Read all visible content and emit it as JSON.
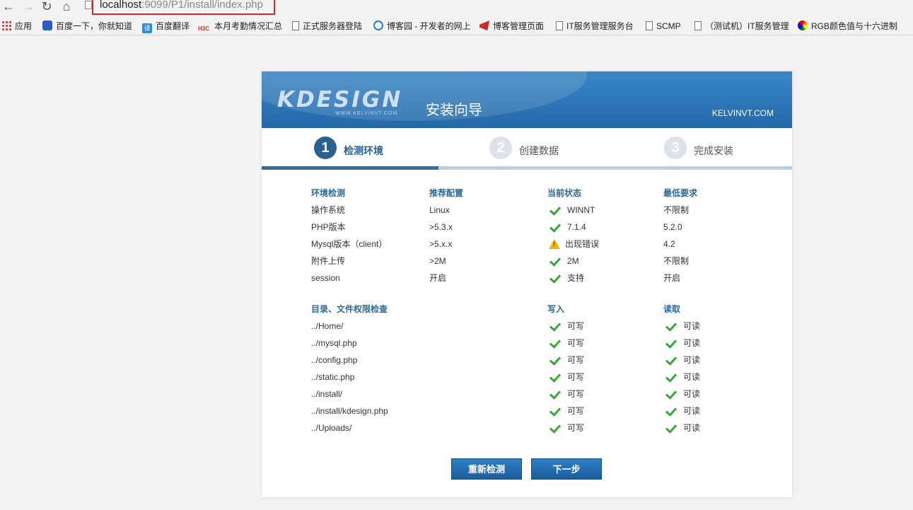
{
  "browser": {
    "url_host": "localhost",
    "url_rest": ":9099/P1/install/index.php",
    "bookmarks": [
      {
        "label": "应用",
        "icon": "apps-grid-icon"
      },
      {
        "label": "百度一下，你就知道",
        "icon": "baidu-paw-icon"
      },
      {
        "label": "百度翻译",
        "icon": "translate-icon"
      },
      {
        "label": "本月考勤情况汇总",
        "icon": "h3c-icon"
      },
      {
        "label": "正式服务器登陆",
        "icon": "page-icon"
      },
      {
        "label": "博客园 - 开发者的网上",
        "icon": "cnblogs-icon"
      },
      {
        "label": "博客管理页面",
        "icon": "red-logo-icon"
      },
      {
        "label": "IT服务管理服务台",
        "icon": "page-icon"
      },
      {
        "label": "SCMP",
        "icon": "page-icon"
      },
      {
        "label": "（测试机）IT服务管理",
        "icon": "page-icon"
      },
      {
        "label": "RGB颜色值与十六进制",
        "icon": "rainbow-icon"
      }
    ]
  },
  "header": {
    "logo": "KDESIGN",
    "logo_sub": "WWW.KELVINVT.COM",
    "title": "安装向导",
    "site": "KELVINVT.COM"
  },
  "steps": [
    {
      "num": "1",
      "label": "检测环境"
    },
    {
      "num": "2",
      "label": "创建数据"
    },
    {
      "num": "3",
      "label": "完成安装"
    }
  ],
  "progress_fraction": 0.333,
  "env": {
    "headers": [
      "环境检测",
      "推荐配置",
      "当前状态",
      "最低要求"
    ],
    "rows": [
      {
        "name": "操作系统",
        "recommend": "Linux",
        "status": "WINNT",
        "min": "不限制"
      },
      {
        "name": "PHP版本",
        "recommend": ">5.3.x",
        "status": "7.1.4",
        "min": "5.2.0"
      },
      {
        "name": "Mysql版本（client）",
        "recommend": ">5.x.x",
        "status": "出现错误",
        "min": "4.2"
      },
      {
        "name": "附件上传",
        "recommend": ">2M",
        "status": "2M",
        "min": "不限制"
      },
      {
        "name": "session",
        "recommend": "开启",
        "status": "支持",
        "min": "开启"
      }
    ]
  },
  "dirs": {
    "headers": [
      "目录、文件权限检查",
      "写入",
      "读取"
    ],
    "write_label": "可写",
    "read_label": "可读",
    "rows": [
      "../Home/",
      "../mysql.php",
      "../config.php",
      "../static.php",
      "../install/",
      "../install/kdesign.php",
      "../Uploads/"
    ]
  },
  "buttons": {
    "recheck": "重新检测",
    "next": "下一步"
  }
}
